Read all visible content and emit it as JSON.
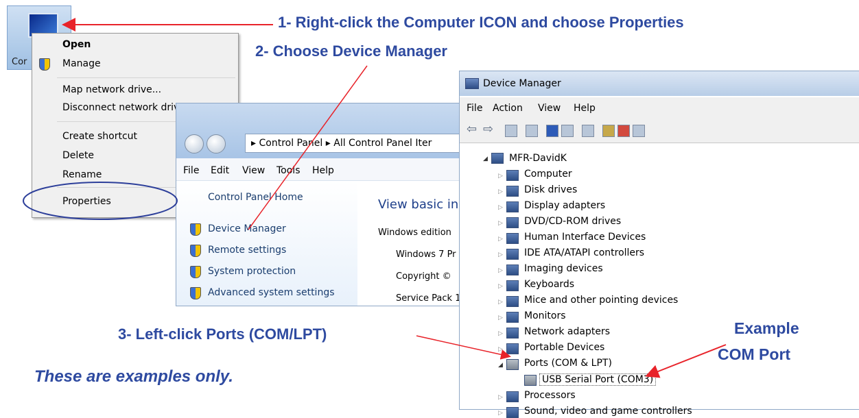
{
  "annotations": {
    "step1": "1- Right-click the Computer ICON and choose Properties",
    "step2": "2- Choose Device Manager",
    "step3": "3- Left-click Ports (COM/LPT)",
    "example_line1": "Example",
    "example_line2": "COM Port",
    "note": "These are examples only."
  },
  "desktop": {
    "icon_label": "Cor"
  },
  "context_menu": {
    "items": [
      "Open",
      "Manage",
      "Map network drive...",
      "Disconnect network driv",
      "Create shortcut",
      "Delete",
      "Rename",
      "Properties"
    ]
  },
  "control_panel": {
    "breadcrumb": [
      "Control Panel",
      "All Control Panel Iter"
    ],
    "menu": [
      "File",
      "Edit",
      "View",
      "Tools",
      "Help"
    ],
    "home_link": "Control Panel Home",
    "links": [
      "Device Manager",
      "Remote settings",
      "System protection",
      "Advanced system settings"
    ],
    "heading": "View basic in",
    "section": "Windows edition",
    "details": [
      "Windows 7 Pr",
      "Copyright © ",
      "Service Pack 1"
    ]
  },
  "device_manager": {
    "title": "Device Manager",
    "menu": [
      "File",
      "Action",
      "View",
      "Help"
    ],
    "root": "MFR-DavidK",
    "items": [
      "Computer",
      "Disk drives",
      "Display adapters",
      "DVD/CD-ROM drives",
      "Human Interface Devices",
      "IDE ATA/ATAPI controllers",
      "Imaging devices",
      "Keyboards",
      "Mice and other pointing devices",
      "Monitors",
      "Network adapters",
      "Portable Devices",
      "Ports (COM & LPT)"
    ],
    "port_child": "USB Serial Port (COM3)",
    "after": [
      "Processors",
      "Sound, video and game controllers"
    ]
  },
  "colors": {
    "annotation": "#2e4aa0",
    "arrow": "#e8232a",
    "highlight_ring": "#2d3f9a"
  }
}
